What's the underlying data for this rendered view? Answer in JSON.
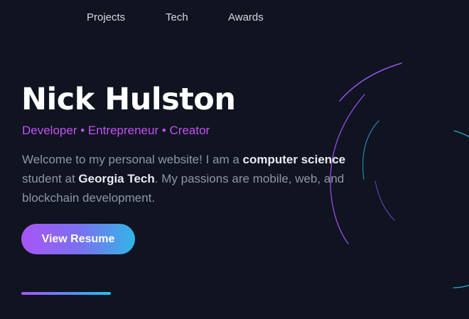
{
  "nav": {
    "items": [
      {
        "label": "Projects"
      },
      {
        "label": "Tech"
      },
      {
        "label": "Awards"
      }
    ]
  },
  "hero": {
    "name": "Nick Hulston",
    "tagline": "Developer • Entrepreneur • Creator",
    "bio": {
      "part1": "Welcome to my personal website! I am a ",
      "bold1": "computer science",
      "part2": " student at ",
      "bold2": "Georgia Tech",
      "part3": ". My passions are mobile, web, and blockchain development."
    },
    "resume_button_label": "View Resume"
  },
  "colors": {
    "background": "#0f1420",
    "accent_purple": "#c44ff5",
    "accent_blue": "#31b6e6",
    "text_muted": "#8e96a6",
    "text_strong": "#e7ebf2"
  }
}
